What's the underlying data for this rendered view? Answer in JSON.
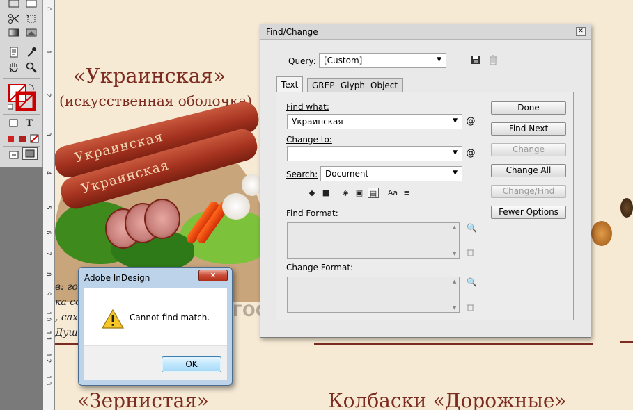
{
  "canvas": {
    "heading_ukr": "«Украинская»",
    "heading_ukr_sub": "(искусственная оболочка)",
    "sausage_label_1": "Украинская",
    "sausage_label_2": "Украинская",
    "heading_zern": "«Зернистая»",
    "heading_kolb": "Колбаски «Дорожные»",
    "body_lines": [
      "в: го",
      "ка со",
      ", сах",
      "Душ"
    ],
    "gost_mark": "ГОСТ"
  },
  "ruler": {
    "numbers": [
      "0",
      "1",
      "2",
      "3",
      "4",
      "5",
      "6",
      "7",
      "8",
      "9",
      "1 0",
      "1 1",
      "1 2",
      "1 3"
    ]
  },
  "find_change": {
    "title": "Find/Change",
    "query_label": "Query:",
    "query_value": "[Custom]",
    "tabs": [
      "Text",
      "GREP",
      "Glyph",
      "Object"
    ],
    "find_what_label": "Find what:",
    "find_what_value": "Украинская",
    "change_to_label": "Change to:",
    "change_to_value": "",
    "search_label": "Search:",
    "search_value": "Document",
    "find_format_label": "Find Format:",
    "change_format_label": "Change Format:",
    "buttons": {
      "done": "Done",
      "find_next": "Find Next",
      "change": "Change",
      "change_all": "Change All",
      "change_find": "Change/Find",
      "fewer_options": "Fewer Options"
    },
    "option_labels": {
      "case": "Aa"
    }
  },
  "alert": {
    "title": "Adobe InDesign",
    "close_glyph": "✕",
    "message": "Cannot find match.",
    "ok_label": "OK"
  },
  "icons": [
    "selection-icon",
    "scissors-icon",
    "gradient-icon",
    "note-icon",
    "eyedropper-icon",
    "hand-icon",
    "zoom-icon",
    "fill-stroke-icon",
    "save-query-icon",
    "delete-query-icon",
    "special-chars-icon",
    "warning-icon",
    "trash-icon",
    "format-icon"
  ]
}
